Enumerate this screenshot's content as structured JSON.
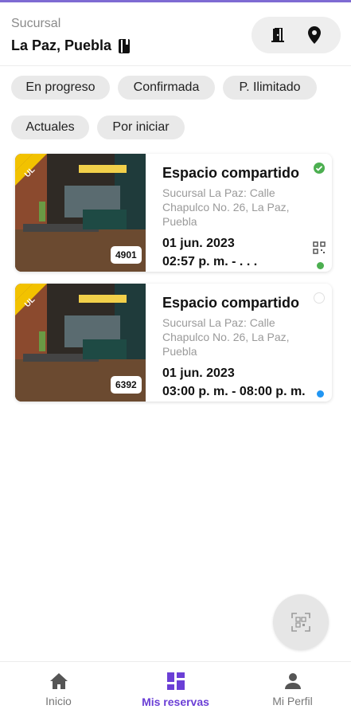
{
  "header": {
    "branch_label": "Sucursal",
    "branch_name": "La Paz, Puebla"
  },
  "filters": [
    {
      "label": "En progreso"
    },
    {
      "label": "Confirmada"
    },
    {
      "label": "P. Ilimitado"
    },
    {
      "label": "Actuales"
    },
    {
      "label": "Por iniciar"
    }
  ],
  "reservations": [
    {
      "title": "Espacio compartido",
      "address": "Sucursal La Paz: Calle Chapulco No. 26, La Paz, Puebla",
      "date": "01 jun. 2023",
      "time": "02:57 p. m. - . . .",
      "code": "4901",
      "ribbon": "UL",
      "status": "confirmed",
      "dot_color": "#4caf50"
    },
    {
      "title": "Espacio compartido",
      "address": "Sucursal La Paz: Calle Chapulco No. 26, La Paz, Puebla",
      "date": "01 jun. 2023",
      "time": "03:00 p. m. - 08:00 p. m.",
      "code": "6392",
      "ribbon": "UL",
      "status": "pending",
      "dot_color": "#2196f3"
    }
  ],
  "nav": [
    {
      "label": "Inicio",
      "icon": "home-icon"
    },
    {
      "label": "Mis reservas",
      "icon": "grid-icon"
    },
    {
      "label": "Mi Perfil",
      "icon": "person-icon"
    }
  ],
  "colors": {
    "accent": "#6b3fd6",
    "confirmed": "#4caf50",
    "ribbon": "#f2c200"
  }
}
